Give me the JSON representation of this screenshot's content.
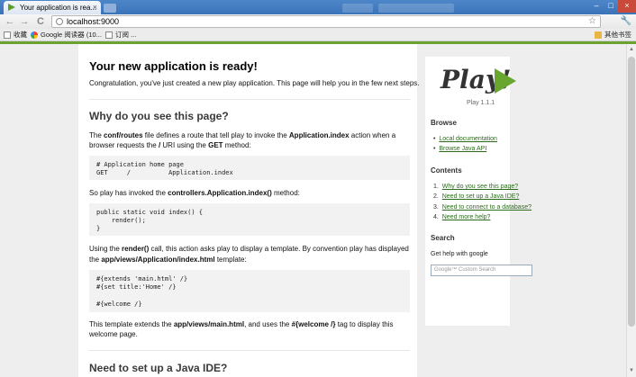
{
  "browser": {
    "tab_title": "Your application is rea...",
    "tab_close": "×",
    "address": "localhost:9000",
    "back": "←",
    "forward": "→",
    "reload": "C",
    "star": "☆",
    "wrench": "🔧",
    "window_controls": [
      "–",
      "□",
      "×"
    ],
    "bookmarks": [
      "收藏",
      "Google 阅读器 (10...",
      "订阅 ...",
      "其他书签"
    ]
  },
  "main": {
    "title": "Your new application is ready!",
    "intro": "Congratulation, you've just created a new play application. This page will help you in the few next steps.",
    "section1": {
      "heading": "Why do you see this page?",
      "p1": {
        "t1": "The ",
        "b1": "conf/routes",
        "t2": " file defines a route that tell play to invoke the ",
        "b2": "Application.index",
        "t3": " action when a",
        "t4": "browser requests the ",
        "b3": "/",
        "t5": " URI using the ",
        "b4": "GET",
        "t6": " method:"
      },
      "code1": [
        "# Application home page",
        "GET     /          Application.index"
      ],
      "p2": {
        "t1": "So play has invoked the ",
        "b1": "controllers.Application.index()",
        "t2": " method:"
      },
      "code2": [
        "public static void index() {",
        "    render();",
        "}"
      ],
      "p3": {
        "t1": "Using the ",
        "b1": "render()",
        "t2": " call, this action asks play to display a template. By convention play has displayed",
        "t3": "the ",
        "b2": "app/views/Application/index.html",
        "t4": " template:"
      },
      "code3": [
        "#{extends 'main.html' /}",
        "#{set title:'Home' /}",
        "",
        "#{welcome /}"
      ],
      "p4": {
        "t1": "This template extends the ",
        "b1": "app/views/main.html",
        "t2": ", and uses the ",
        "b2": "#{welcome /}",
        "t3": " tag to display this",
        "t4": "welcome page."
      }
    },
    "section2": {
      "heading": "Need to set up a Java IDE?"
    }
  },
  "sidebar": {
    "logo_text": "Play!",
    "version": "Play 1.1.1",
    "browse_title": "Browse",
    "browse_links": [
      "Local documentation",
      "Browse Java API"
    ],
    "contents_title": "Contents",
    "contents": [
      {
        "num": "1.",
        "label": "Why do you see this page?"
      },
      {
        "num": "2.",
        "label": "Need to set up a Java IDE?"
      },
      {
        "num": "3.",
        "label": "Need to connect to a database?"
      },
      {
        "num": "4.",
        "label": "Need more help?"
      }
    ],
    "search_title": "Search",
    "search_text": "Get help with google",
    "search_placeholder": "Google™ Custom Search"
  },
  "colors": {
    "link": "#2c6b1c",
    "accent": "#69a630",
    "code_bg": "#f2f2f2"
  }
}
